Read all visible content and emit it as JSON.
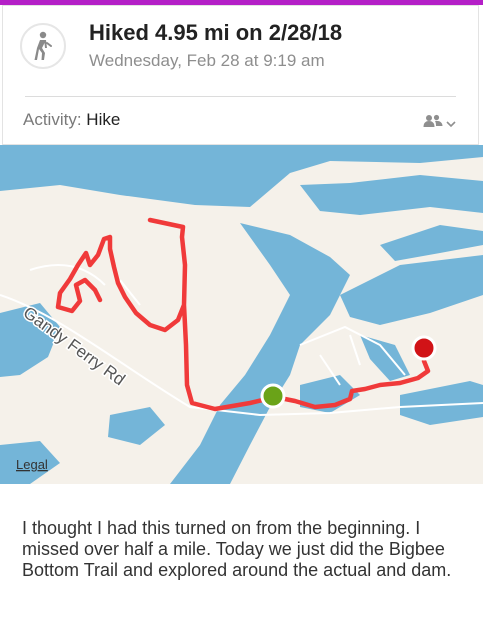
{
  "colors": {
    "accent_bar": "#b41fc7",
    "route": "#f03a3a",
    "start_marker": "#6aa318",
    "end_marker": "#d11317",
    "water": "#74b5d8",
    "land": "#f5f1ea"
  },
  "activity_card": {
    "icon": "hiker-icon",
    "title": "Hiked 4.95 mi on 2/28/18",
    "datetime": "Wednesday, Feb 28 at 9:19 am",
    "activity_label": "Activity:",
    "activity_value": "Hike",
    "audience_icon": "friends-icon",
    "dropdown_icon": "chevron-down-icon"
  },
  "map": {
    "road_label": "Gandy Ferry Rd",
    "legal_link": "Legal",
    "start_marker": "start-marker",
    "end_marker": "end-marker"
  },
  "note": {
    "text": "I thought I had this turned on from the beginning. I missed over half a mile. Today we just did the Bigbee Bottom Trail and explored around the actual and dam."
  }
}
